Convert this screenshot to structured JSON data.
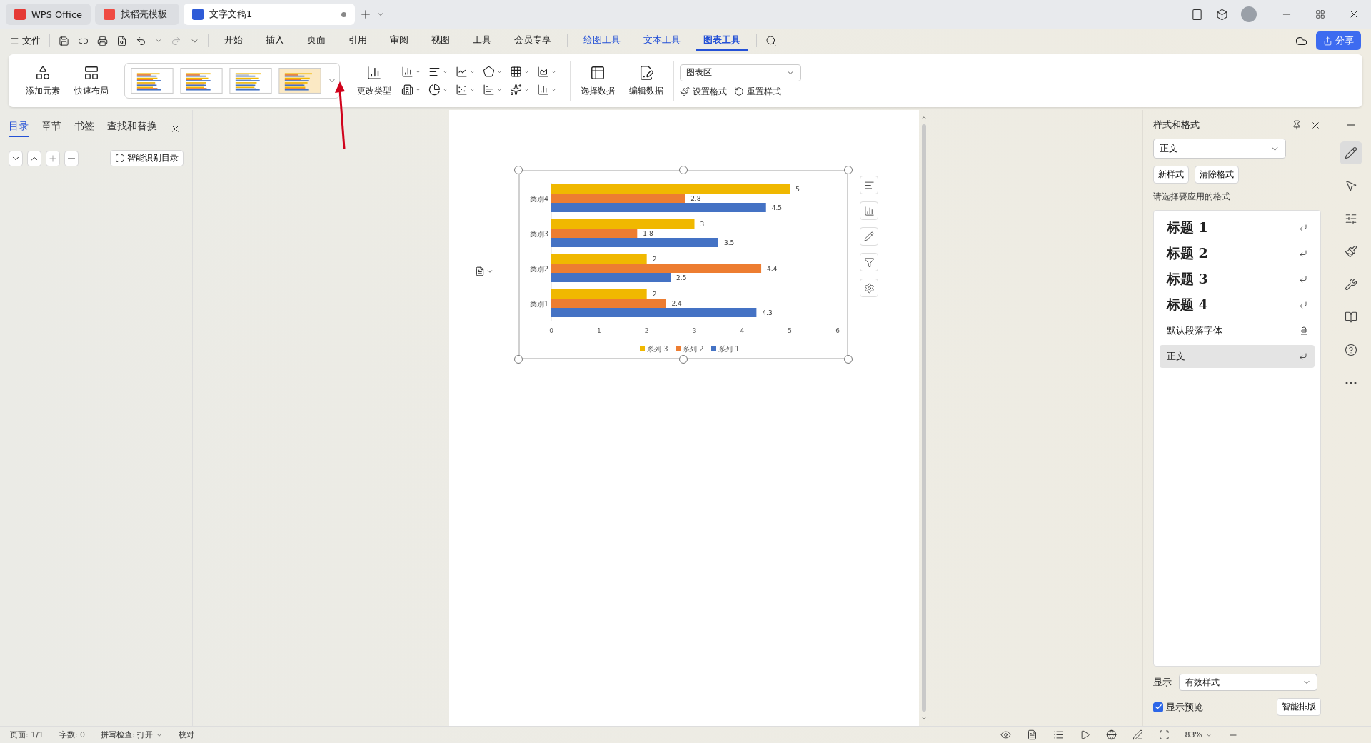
{
  "tabs": [
    {
      "label": "WPS Office",
      "selected": false,
      "kind": "home"
    },
    {
      "label": "找稻壳模板",
      "selected": false,
      "kind": "template"
    },
    {
      "label": "文字文稿1",
      "selected": true,
      "kind": "doc"
    }
  ],
  "menu": {
    "file": "文件",
    "items": [
      {
        "label": "开始",
        "selected": false,
        "kind": "main"
      },
      {
        "label": "插入",
        "selected": false,
        "kind": "main"
      },
      {
        "label": "页面",
        "selected": false,
        "kind": "main"
      },
      {
        "label": "引用",
        "selected": false,
        "kind": "main"
      },
      {
        "label": "审阅",
        "selected": false,
        "kind": "main"
      },
      {
        "label": "视图",
        "selected": false,
        "kind": "main"
      },
      {
        "label": "工具",
        "selected": false,
        "kind": "main"
      },
      {
        "label": "会员专享",
        "selected": false,
        "kind": "main"
      },
      {
        "label": "绘图工具",
        "selected": false,
        "kind": "context"
      },
      {
        "label": "文本工具",
        "selected": false,
        "kind": "context"
      },
      {
        "label": "图表工具",
        "selected": true,
        "kind": "context"
      }
    ],
    "share": "分享"
  },
  "ribbon": {
    "add_element": "添加元素",
    "quick_layout": "快速布局",
    "change_type": "更改类型",
    "select_data": "选择数据",
    "edit_data": "编辑数据",
    "area": "图表区",
    "set_format": "设置格式",
    "reset_style": "重置样式"
  },
  "nav_panel": {
    "tabs": [
      {
        "label": "目录",
        "selected": true
      },
      {
        "label": "章节",
        "selected": false
      },
      {
        "label": "书签",
        "selected": false
      },
      {
        "label": "查找和替换",
        "selected": false
      }
    ],
    "smart_toc": "智能识别目录"
  },
  "chart": {
    "chart_data": {
      "type": "bar",
      "orientation": "horizontal",
      "categories": [
        "类别4",
        "类别3",
        "类别2",
        "类别1"
      ],
      "series": [
        {
          "name": "系列 1",
          "color": "#4472c4",
          "values": [
            4.5,
            3.5,
            2.5,
            4.3
          ]
        },
        {
          "name": "系列 2",
          "color": "#ed7d31",
          "values": [
            2.8,
            1.8,
            4.4,
            2.4
          ]
        },
        {
          "name": "系列 3",
          "color": "#f0b800",
          "values": [
            5,
            3,
            2,
            2
          ]
        }
      ],
      "xlim": [
        0,
        6
      ],
      "xticks": [
        0,
        1,
        2,
        3,
        4,
        5,
        6
      ],
      "data_labels": true,
      "legend": "bottom"
    }
  },
  "styles_panel": {
    "title": "样式和格式",
    "current": "正文",
    "new_style": "新样式",
    "clear_format": "清除格式",
    "prompt": "请选择要应用的格式",
    "styles": [
      {
        "label": "标题 1",
        "kind": "heading",
        "selected": false
      },
      {
        "label": "标题 2",
        "kind": "heading",
        "selected": false
      },
      {
        "label": "标题 3",
        "kind": "heading",
        "selected": false
      },
      {
        "label": "标题 4",
        "kind": "heading",
        "selected": false
      },
      {
        "label": "默认段落字体",
        "kind": "character",
        "selected": false
      },
      {
        "label": "正文",
        "kind": "paragraph",
        "selected": true
      }
    ],
    "show_label": "显示",
    "show_value": "有效样式",
    "preview": {
      "label": "显示预览",
      "checked": true
    },
    "smart_layout": "智能排版"
  },
  "status_bar": {
    "page": "页面: 1/1",
    "words": "字数: 0",
    "spell": "拼写检查: 打开",
    "proof": "校对",
    "zoom": "83%"
  }
}
